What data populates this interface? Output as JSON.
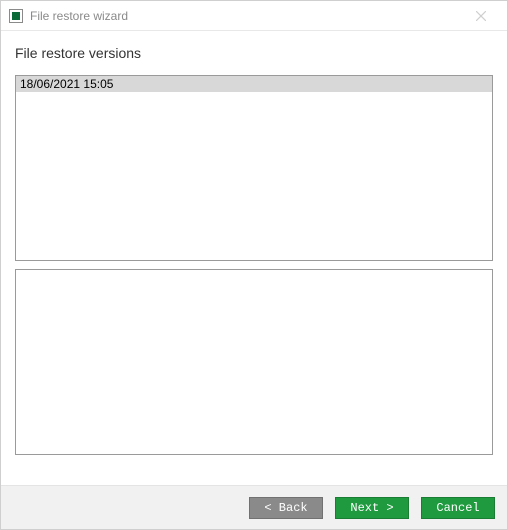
{
  "window": {
    "title": "File restore wizard"
  },
  "heading": "File restore versions",
  "versions": {
    "items": [
      "18/06/2021 15:05"
    ],
    "selected_index": 0
  },
  "buttons": {
    "back": "< Back",
    "next": "Next >",
    "cancel": "Cancel"
  }
}
